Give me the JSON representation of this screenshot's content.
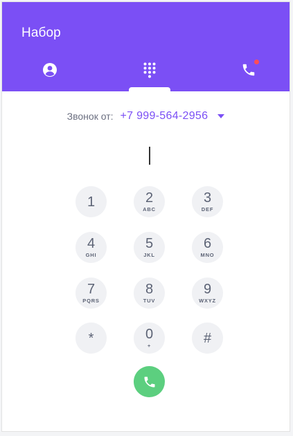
{
  "header": {
    "title": "Набор",
    "tabs": [
      {
        "name": "contacts",
        "icon": "person-circle-icon"
      },
      {
        "name": "dialpad",
        "icon": "dialpad-icon"
      },
      {
        "name": "calls",
        "icon": "phone-icon",
        "has_notification": true
      }
    ],
    "colors": {
      "accent": "#7b4ff5",
      "notification": "#ff4c58"
    }
  },
  "caller": {
    "label": "Звонок от:",
    "number": "+7 999-564-2956"
  },
  "dial_input": {
    "value": ""
  },
  "keypad": {
    "keys": [
      {
        "digit": "1",
        "letters": ""
      },
      {
        "digit": "2",
        "letters": "ABC"
      },
      {
        "digit": "3",
        "letters": "DEF"
      },
      {
        "digit": "4",
        "letters": "GHI"
      },
      {
        "digit": "5",
        "letters": "JKL"
      },
      {
        "digit": "6",
        "letters": "MNO"
      },
      {
        "digit": "7",
        "letters": "PQRS"
      },
      {
        "digit": "8",
        "letters": "TUV"
      },
      {
        "digit": "9",
        "letters": "WXYZ"
      },
      {
        "digit": "*",
        "letters": ""
      },
      {
        "digit": "0",
        "letters": "+"
      },
      {
        "digit": "#",
        "letters": ""
      }
    ]
  },
  "call_button": {
    "icon": "phone-icon",
    "color": "#5ccf7f"
  }
}
